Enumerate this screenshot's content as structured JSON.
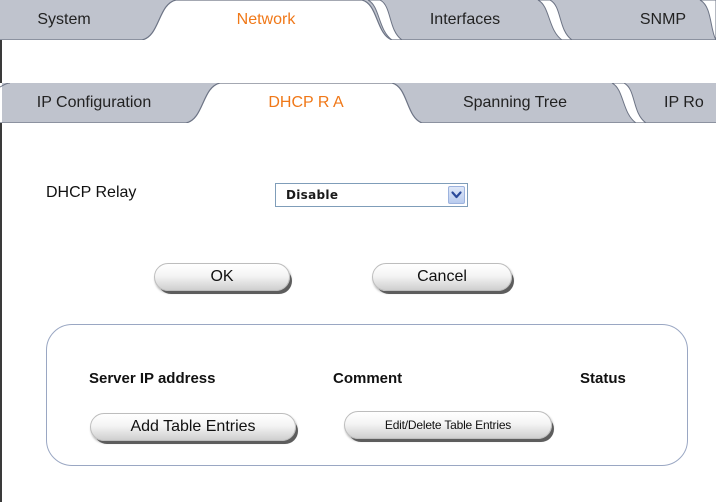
{
  "top_tabs": [
    {
      "label": "System",
      "active": false
    },
    {
      "label": "Network",
      "active": true
    },
    {
      "label": "Interfaces",
      "active": false
    },
    {
      "label": "SNMP",
      "active": false
    }
  ],
  "sub_tabs": [
    {
      "label": "IP Configuration",
      "active": false
    },
    {
      "label": "DHCP R A",
      "active": true
    },
    {
      "label": "Spanning Tree",
      "active": false
    },
    {
      "label": "IP Ro",
      "active": false
    }
  ],
  "dhcp_relay": {
    "label": "DHCP Relay",
    "selected": "Disable"
  },
  "buttons": {
    "ok": "OK",
    "cancel": "Cancel"
  },
  "table": {
    "columns": [
      "Server IP address",
      "Comment",
      "Status"
    ],
    "add_label": "Add Table Entries",
    "edit_label": "Edit/Delete Table Entries"
  },
  "colors": {
    "active_tab_text": "#f07818",
    "inactive_tab_fill": "#bfc3cd",
    "tab_line": "#6d7485"
  }
}
